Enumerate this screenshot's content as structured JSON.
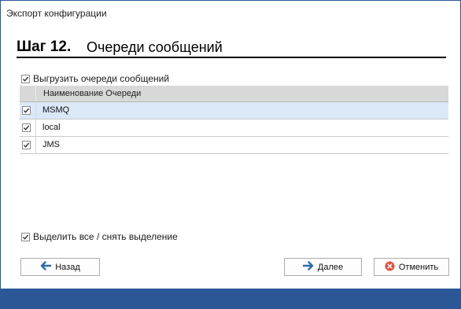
{
  "window": {
    "title": "Экспорт конфигурации"
  },
  "step": {
    "number": "Шаг 12.",
    "title": "Очереди сообщений"
  },
  "export_option": {
    "label": "Выгрузить очереди сообщений",
    "checked": true
  },
  "grid": {
    "column_header": "Наименование Очереди",
    "rows": [
      {
        "name": "MSMQ",
        "checked": true,
        "selected": true
      },
      {
        "name": "local",
        "checked": true,
        "selected": false
      },
      {
        "name": "JMS",
        "checked": true,
        "selected": false
      }
    ]
  },
  "select_all": {
    "label": "Выделить все / снять выделение",
    "checked": true
  },
  "buttons": {
    "back": {
      "label": "Назад",
      "icon": "arrow-left-icon"
    },
    "next": {
      "label": "Далее",
      "icon": "arrow-right-icon"
    },
    "cancel": {
      "label": "Отменить",
      "icon": "cancel-circle-icon"
    }
  },
  "colors": {
    "accent": "#2b5797",
    "selected_row": "#dbe8f7",
    "header_bg": "#d8d8d8",
    "icon_blue": "#2b6cb0",
    "cancel_red": "#e74c3c"
  }
}
